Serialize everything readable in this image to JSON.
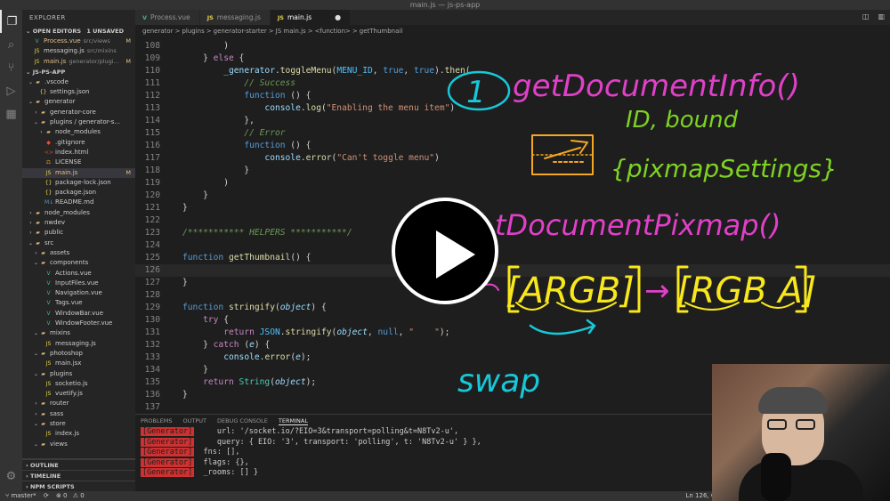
{
  "window": {
    "title": "main.js — js-ps-app"
  },
  "sidebar": {
    "title": "EXPLORER",
    "open_editors": {
      "label": "OPEN EDITORS",
      "badge": "1 UNSAVED",
      "items": [
        {
          "label": "Process.vue",
          "desc": "src/views",
          "badge": "M",
          "icon": "V"
        },
        {
          "label": "messaging.js",
          "desc": "src/mixins",
          "badge": "",
          "icon": "JS"
        },
        {
          "label": "main.js",
          "desc": "generator/plugi...",
          "badge": "M",
          "icon": "JS"
        }
      ]
    },
    "project": {
      "label": "JS-PS-APP"
    },
    "tree": [
      {
        "label": ".vscode",
        "depth": 1,
        "type": "folder",
        "open": true
      },
      {
        "label": "settings.json",
        "depth": 2,
        "type": "json"
      },
      {
        "label": "generator",
        "depth": 1,
        "type": "folder",
        "open": true
      },
      {
        "label": "generator-core",
        "depth": 2,
        "type": "folder",
        "open": false
      },
      {
        "label": "plugins / generator-s...",
        "depth": 2,
        "type": "folder",
        "open": true
      },
      {
        "label": "node_modules",
        "depth": 3,
        "type": "folder",
        "open": false
      },
      {
        "label": ".gitignore",
        "depth": 3,
        "type": "git"
      },
      {
        "label": "index.html",
        "depth": 3,
        "type": "html"
      },
      {
        "label": "LICENSE",
        "depth": 3,
        "type": "license"
      },
      {
        "label": "main.js",
        "depth": 3,
        "type": "js",
        "badge": "M",
        "selected": true
      },
      {
        "label": "package-lock.json",
        "depth": 3,
        "type": "json"
      },
      {
        "label": "package.json",
        "depth": 3,
        "type": "json"
      },
      {
        "label": "README.md",
        "depth": 3,
        "type": "md"
      },
      {
        "label": "node_modules",
        "depth": 1,
        "type": "folder",
        "open": false
      },
      {
        "label": "nwdev",
        "depth": 1,
        "type": "folder",
        "open": false
      },
      {
        "label": "public",
        "depth": 1,
        "type": "folder",
        "open": false
      },
      {
        "label": "src",
        "depth": 1,
        "type": "folder",
        "open": true
      },
      {
        "label": "assets",
        "depth": 2,
        "type": "folder",
        "open": false
      },
      {
        "label": "components",
        "depth": 2,
        "type": "folder",
        "open": true
      },
      {
        "label": "Actions.vue",
        "depth": 3,
        "type": "vue"
      },
      {
        "label": "InputFiles.vue",
        "depth": 3,
        "type": "vue"
      },
      {
        "label": "Navigation.vue",
        "depth": 3,
        "type": "vue"
      },
      {
        "label": "Tags.vue",
        "depth": 3,
        "type": "vue"
      },
      {
        "label": "WindowBar.vue",
        "depth": 3,
        "type": "vue"
      },
      {
        "label": "WindowFooter.vue",
        "depth": 3,
        "type": "vue"
      },
      {
        "label": "mixins",
        "depth": 2,
        "type": "folder",
        "open": true
      },
      {
        "label": "messaging.js",
        "depth": 3,
        "type": "js"
      },
      {
        "label": "photoshop",
        "depth": 2,
        "type": "folder",
        "open": true
      },
      {
        "label": "main.jsx",
        "depth": 3,
        "type": "js"
      },
      {
        "label": "plugins",
        "depth": 2,
        "type": "folder",
        "open": true
      },
      {
        "label": "socketio.js",
        "depth": 3,
        "type": "js"
      },
      {
        "label": "vuetify.js",
        "depth": 3,
        "type": "js"
      },
      {
        "label": "router",
        "depth": 2,
        "type": "folder",
        "open": false
      },
      {
        "label": "sass",
        "depth": 2,
        "type": "folder",
        "open": false
      },
      {
        "label": "store",
        "depth": 2,
        "type": "folder",
        "open": true
      },
      {
        "label": "index.js",
        "depth": 3,
        "type": "js"
      },
      {
        "label": "views",
        "depth": 2,
        "type": "folder",
        "open": true
      }
    ],
    "bottom_sections": [
      "OUTLINE",
      "TIMELINE",
      "NPM SCRIPTS"
    ]
  },
  "tabs": [
    {
      "label": "Process.vue",
      "icon": "V",
      "active": false
    },
    {
      "label": "messaging.js",
      "icon": "JS",
      "active": false
    },
    {
      "label": "main.js",
      "icon": "JS",
      "active": true,
      "dirty": "●"
    }
  ],
  "breadcrumb": [
    "generator",
    ">",
    "plugins",
    ">",
    "generator-starter",
    ">",
    "JS main.js",
    ">",
    "<function>",
    ">",
    "getThumbnail"
  ],
  "editor": {
    "lines": [
      {
        "n": "108",
        "code": "        )"
      },
      {
        "n": "109",
        "code": "    } else {"
      },
      {
        "n": "110",
        "code": "        _generator.toggleMenu(MENU_ID, true, true).then("
      },
      {
        "n": "111",
        "code": "            // Success"
      },
      {
        "n": "112",
        "code": "            function () {"
      },
      {
        "n": "113",
        "code": "                console.log(\"Enabling the menu item\")"
      },
      {
        "n": "114",
        "code": "            },"
      },
      {
        "n": "115",
        "code": "            // Error"
      },
      {
        "n": "116",
        "code": "            function () {"
      },
      {
        "n": "117",
        "code": "                console.error(\"Can't toggle menu\")"
      },
      {
        "n": "118",
        "code": "            }"
      },
      {
        "n": "119",
        "code": "        )"
      },
      {
        "n": "120",
        "code": "    }"
      },
      {
        "n": "121",
        "code": "}"
      },
      {
        "n": "122",
        "code": ""
      },
      {
        "n": "123",
        "code": "/*********** HELPERS ***********/"
      },
      {
        "n": "124",
        "code": ""
      },
      {
        "n": "125",
        "code": "function getThumbnail() {"
      },
      {
        "n": "126",
        "code": ""
      },
      {
        "n": "127",
        "code": "}"
      },
      {
        "n": "128",
        "code": ""
      },
      {
        "n": "129",
        "code": "function stringify(object) {"
      },
      {
        "n": "130",
        "code": "    try {"
      },
      {
        "n": "131",
        "code": "        return JSON.stringify(object, null, \"    \");"
      },
      {
        "n": "132",
        "code": "    } catch (e) {"
      },
      {
        "n": "133",
        "code": "        console.error(e);"
      },
      {
        "n": "134",
        "code": "    }"
      },
      {
        "n": "135",
        "code": "    return String(object);"
      },
      {
        "n": "136",
        "code": "}"
      },
      {
        "n": "137",
        "code": ""
      }
    ]
  },
  "annotations": {
    "number": "1",
    "line1": "getDocumentInfo()",
    "line2": "ID, bound",
    "line3": "{pixmapSettings}",
    "line4": "tDocumentPixmap()",
    "argb": "[ARGB]",
    "arrow": "→",
    "rgba": "[RGB A]",
    "swap": "swap"
  },
  "panel": {
    "tabs": [
      "PROBLEMS",
      "OUTPUT",
      "DEBUG CONSOLE",
      "TERMINAL"
    ],
    "active_tab": "TERMINAL",
    "lines": [
      {
        "tag": "[Generator]",
        "text": "     url: '/socket.io/?EIO=3&transport=polling&t=N8Tv2-u',"
      },
      {
        "tag": "[Generator]",
        "text": "     query: { EIO: '3', transport: 'polling', t: 'N8Tv2-u' } },"
      },
      {
        "tag": "[Generator]",
        "text": "  fns: [],"
      },
      {
        "tag": "[Generator]",
        "text": "  flags: {},"
      },
      {
        "tag": "[Generator]",
        "text": "  _rooms: [] }"
      }
    ]
  },
  "status": {
    "branch": "master*",
    "sync": "⟳",
    "errors": "⊗ 0",
    "warnings": "⚠ 0",
    "position": "Ln 126, Col"
  },
  "colors": {
    "accent": "#007acc",
    "annotation_pink": "#e040c8",
    "annotation_green": "#7ed321",
    "annotation_orange": "#f5a623",
    "annotation_yellow": "#f8e71c",
    "annotation_teal": "#17c8d8",
    "terminal_tag": "#cd3131"
  }
}
